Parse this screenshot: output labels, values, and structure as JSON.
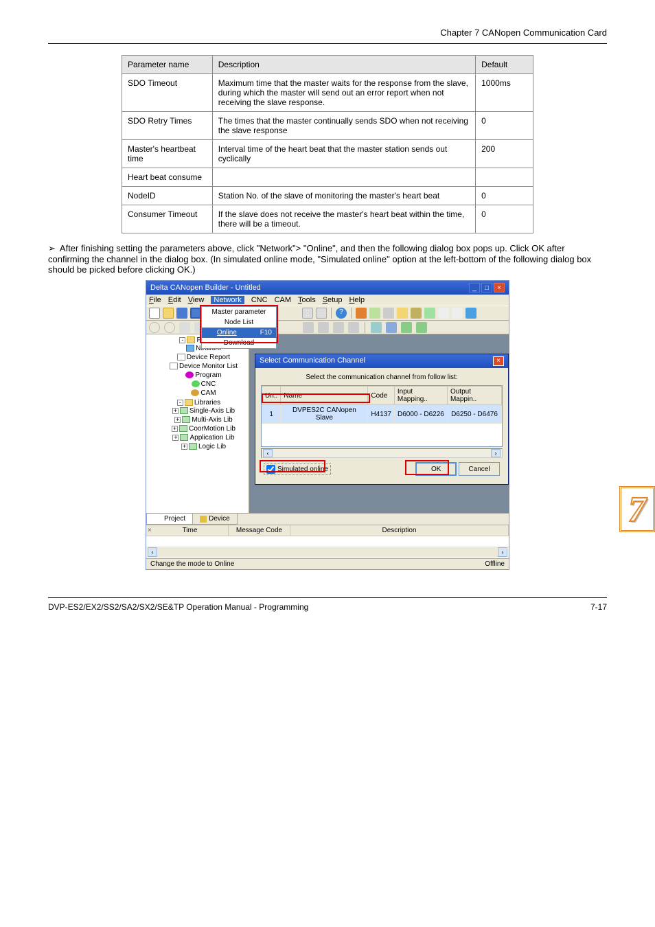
{
  "header": {
    "chapter": "Chapter 7 CANopen Communication Card"
  },
  "params_table": {
    "headers": [
      "Parameter name",
      "Description",
      "Default"
    ],
    "rows": [
      [
        "SDO Timeout",
        "Maximum time that the master waits for the response from the slave, during which the master will send out an error report when not receiving the slave response.",
        "1000ms"
      ],
      [
        "SDO Retry Times",
        "The times that the master continually sends SDO when not receiving the slave response",
        "0"
      ],
      [
        "Master's heartbeat time",
        "Interval time of the heart beat that the master station sends out cyclically",
        "200"
      ],
      [
        "Heart beat consume",
        "",
        ""
      ],
      [
        "NodeID",
        "Station No. of the slave of monitoring the master's heart beat",
        "0"
      ],
      [
        "Consumer Timeout",
        "If the slave does not receive the master's heart beat within the time, there will be a timeout.",
        "0"
      ]
    ]
  },
  "paragraph": "After finishing setting the parameters above, click \"Network\"> \"Online\", and then the following dialog box pops up. Click OK after confirming the channel in the dialog box. (In simulated online mode, \"Simulated online\" option at the left-bottom of the following dialog box should be picked before clicking OK.)",
  "app": {
    "title": "Delta CANopen Builder - Untitled",
    "menus": [
      "File",
      "Edit",
      "View",
      "Network",
      "CNC",
      "CAM",
      "Tools",
      "Setup",
      "Help"
    ],
    "dropdown": {
      "items": [
        "Master parameter",
        "Node List",
        "Online",
        "Download"
      ],
      "hotkey": "F10",
      "highlighted": "Online"
    },
    "tree": {
      "root": "Project",
      "items": [
        "Network",
        "Device Report",
        "Device Monitor List",
        "Program",
        "CNC",
        "CAM"
      ],
      "libs_root": "Libraries",
      "libs": [
        "Single-Axis Lib",
        "Multi-Axis Lib",
        "CoorMotion Lib",
        "Application Lib",
        "Logic Lib"
      ]
    },
    "tabs": {
      "project": "Project",
      "device": "Device"
    },
    "msg_headers": [
      "Time",
      "Message Code",
      "Description"
    ],
    "status_left": "Change the mode to Online",
    "status_right": "Offline",
    "close_x": "×"
  },
  "dialog": {
    "title": "Select Communication Channel",
    "instruction": "Select the communication channel from follow list:",
    "cols": [
      "Un..",
      "Name",
      "Code",
      "Input Mapping..",
      "Output Mappin.."
    ],
    "row": [
      "1",
      "DVPES2C CANopen Slave",
      "H4137",
      "D6000 - D6226",
      "D6250 - D6476"
    ],
    "sim": "Simulated online",
    "ok": "OK",
    "cancel": "Cancel"
  },
  "badge": "7",
  "footer": {
    "left": "DVP-ES2/EX2/SS2/SA2/SX2/SE&TP Operation Manual - Programming",
    "right": "7-17"
  }
}
